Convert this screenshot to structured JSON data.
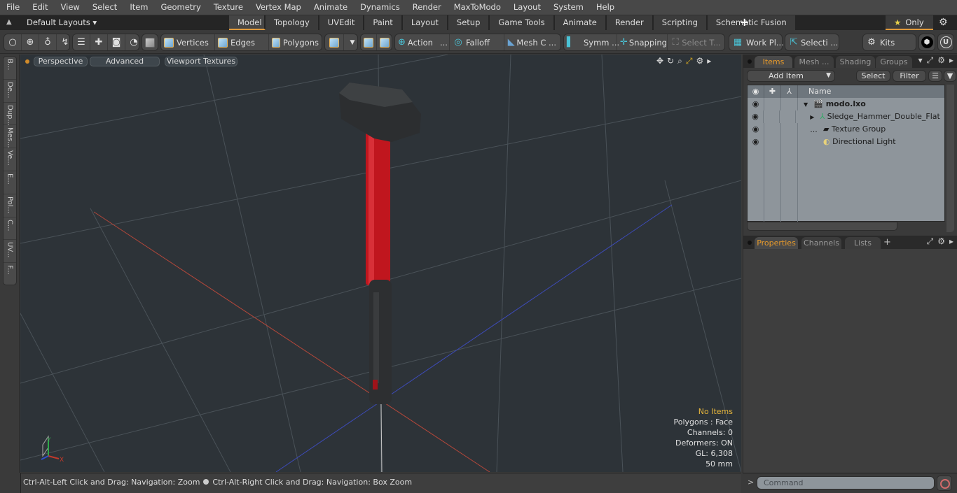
{
  "menu": [
    "File",
    "Edit",
    "View",
    "Select",
    "Item",
    "Geometry",
    "Texture",
    "Vertex Map",
    "Animate",
    "Dynamics",
    "Render",
    "MaxToModo",
    "Layout",
    "System",
    "Help"
  ],
  "layoutbar": {
    "layouts_label": "Default Layouts",
    "tabs": [
      "Model",
      "Topology",
      "UVEdit",
      "Paint",
      "Layout",
      "Setup",
      "Game Tools",
      "Animate",
      "Render",
      "Scripting",
      "Schematic Fusion"
    ],
    "active_tab": "Model",
    "add_tab_label": "+",
    "only_label": "Only"
  },
  "toolbar": {
    "vertices": "Vertices",
    "edges": "Edges",
    "polygons": "Polygons",
    "action": "Action",
    "action_more": "...",
    "falloff": "Falloff",
    "mesh_c": "Mesh C ...",
    "symm": "Symm ...",
    "snapping": "Snapping",
    "select_t": "Select T...",
    "work_pl": "Work Pl...",
    "selecti": "Selecti ...",
    "kits": "Kits"
  },
  "left_tabs": [
    "B...",
    "De...",
    "Dup...",
    "Mes...",
    "Ve...",
    "E...",
    "Pol...",
    "C...",
    "UV...",
    "F..."
  ],
  "viewport": {
    "buttons": [
      "Perspective",
      "Advanced",
      "Viewport Textures"
    ],
    "info": {
      "selection": "No Items",
      "polygons": "Polygons : Face",
      "channels": "Channels: 0",
      "deformers": "Deformers: ON",
      "gl": "GL: 6,308",
      "scale": "50 mm"
    },
    "axis_labels": {
      "x": "X",
      "y": "Y",
      "z": "Z"
    }
  },
  "statusbar": {
    "hint1": "Ctrl-Alt-Left Click and Drag: Navigation: Zoom",
    "hint2": "Ctrl-Alt-Right Click and Drag: Navigation: Box Zoom"
  },
  "items_panel": {
    "tabs": [
      "Items",
      "Mesh ...",
      "Shading",
      "Groups"
    ],
    "active_tab": "Items",
    "add_item": "Add Item",
    "select": "Select",
    "filter": "Filter",
    "column_name": "Name",
    "rows": [
      {
        "name": "modo.lxo",
        "bold": true
      },
      {
        "name": "Sledge_Hammer_Double_Flat ...",
        "bold": false
      },
      {
        "name": "Texture Group",
        "bold": false
      },
      {
        "name": "Directional Light",
        "bold": false
      }
    ]
  },
  "properties_panel": {
    "tabs": [
      "Properties",
      "Channels",
      "Lists"
    ],
    "active_tab": "Properties",
    "add_label": "+"
  },
  "command": {
    "prompt": ">",
    "placeholder": "Command"
  }
}
